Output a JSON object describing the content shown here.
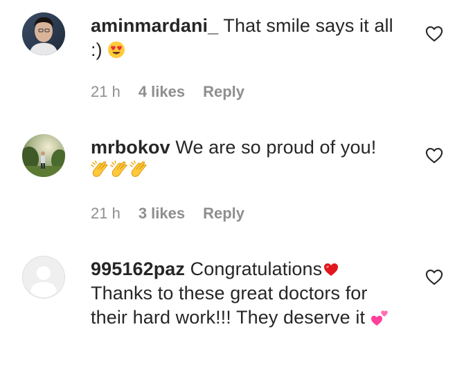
{
  "comments": [
    {
      "username": "aminmardani_",
      "text": "That smile says it all :)",
      "emoji": "heart-eyes",
      "time": "21 h",
      "likes": "4 likes",
      "reply": "Reply"
    },
    {
      "username": "mrbokov",
      "text": "We are so proud of you!",
      "emoji": "clapping-hands x3",
      "time": "21 h",
      "likes": "3 likes",
      "reply": "Reply"
    },
    {
      "username": "995162paz",
      "text_1": "Congratulations",
      "text_2": "Thanks to these great doctors for their hard work!!! They deserve it",
      "emoji": "red-heart, two-hearts",
      "time": "",
      "likes": "",
      "reply": ""
    }
  ],
  "colors": {
    "text": "#262626",
    "meta": "#8e8e8e",
    "like_icon": "#262626",
    "heart_red": "#e0171c",
    "two_hearts": "#ff4fa3"
  }
}
